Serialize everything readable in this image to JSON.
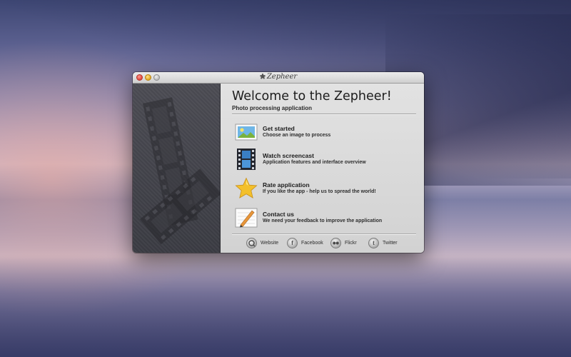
{
  "window": {
    "title": "Zepheer"
  },
  "welcome": {
    "heading": "Welcome to the Zepheer!",
    "subtitle": "Photo processing application"
  },
  "items": [
    {
      "title": "Get started",
      "desc": "Choose an image to process",
      "icon": "picture-icon"
    },
    {
      "title": "Watch screencast",
      "desc": "Application features and interface overview",
      "icon": "film-icon"
    },
    {
      "title": "Rate application",
      "desc": "If you like the app - help us to spread the world!",
      "icon": "star-icon"
    },
    {
      "title": "Contact us",
      "desc": "We need your feedback to improve the application",
      "icon": "pencil-letter-icon"
    }
  ],
  "links": [
    {
      "label": "Website",
      "icon": "website-icon"
    },
    {
      "label": "Facebook",
      "icon": "facebook-icon",
      "glyph": "f"
    },
    {
      "label": "Flickr",
      "icon": "flickr-icon"
    },
    {
      "label": "Twitter",
      "icon": "twitter-icon",
      "glyph": "t"
    }
  ],
  "colors": {
    "star": "#f3c02b",
    "picture_sky": "#6fb6e6",
    "picture_grass": "#7ab23d"
  }
}
